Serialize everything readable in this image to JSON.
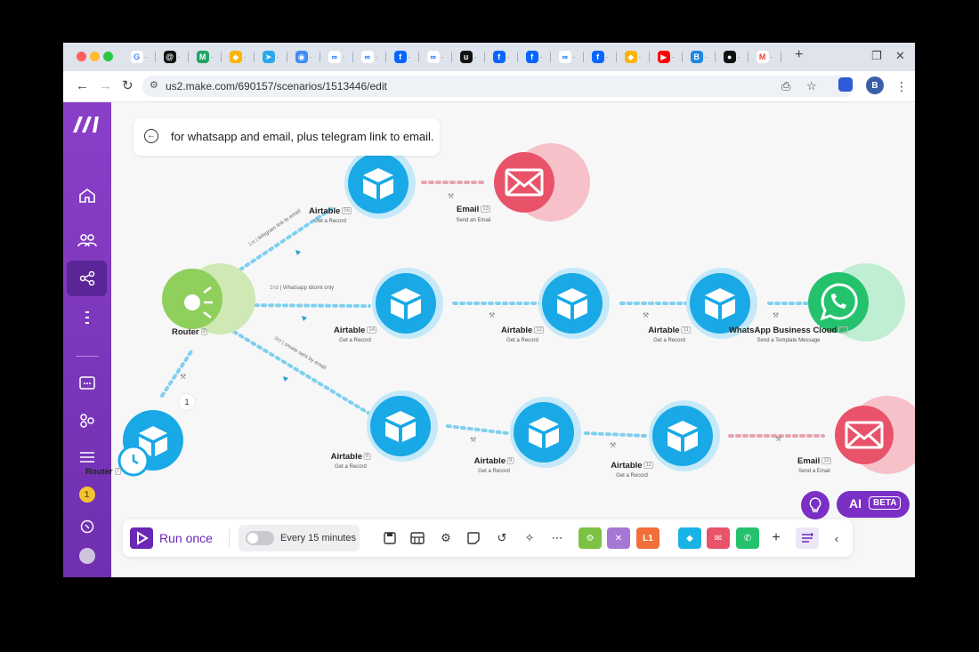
{
  "browser": {
    "tabs": [
      {
        "icon": "google-icon",
        "color": "#ffffff",
        "fg": "#4285f4",
        "glyph": "G"
      },
      {
        "icon": "threads-icon",
        "color": "#111111",
        "fg": "#ffffff",
        "glyph": "@"
      },
      {
        "icon": "sheets-icon",
        "color": "#1fa463",
        "fg": "#ffffff",
        "glyph": "M"
      },
      {
        "icon": "airtable-icon",
        "color": "#fcb400",
        "fg": "#ffffff",
        "glyph": "◆"
      },
      {
        "icon": "telegram-icon",
        "color": "#29a9eb",
        "fg": "#ffffff",
        "glyph": "➤"
      },
      {
        "icon": "app-icon",
        "color": "#3d8df5",
        "fg": "#ffffff",
        "glyph": "◉"
      },
      {
        "icon": "meta-icon",
        "color": "#ffffff",
        "fg": "#0866ff",
        "glyph": "∞"
      },
      {
        "icon": "meta-icon",
        "color": "#ffffff",
        "fg": "#0866ff",
        "glyph": "∞"
      },
      {
        "icon": "facebook-icon",
        "color": "#0866ff",
        "fg": "#ffffff",
        "glyph": "f"
      },
      {
        "icon": "meta-icon",
        "color": "#ffffff",
        "fg": "#0866ff",
        "glyph": "∞"
      },
      {
        "icon": "upwork-icon",
        "color": "#111111",
        "fg": "#ffffff",
        "glyph": "u"
      },
      {
        "icon": "facebook-icon",
        "color": "#0866ff",
        "fg": "#ffffff",
        "glyph": "f"
      },
      {
        "icon": "facebook-icon",
        "color": "#0866ff",
        "fg": "#ffffff",
        "glyph": "f"
      },
      {
        "icon": "meta-icon",
        "color": "#ffffff",
        "fg": "#0866ff",
        "glyph": "∞"
      },
      {
        "icon": "facebook-icon",
        "color": "#0866ff",
        "fg": "#ffffff",
        "glyph": "f"
      },
      {
        "icon": "airtable-icon",
        "color": "#fcb400",
        "fg": "#ffffff",
        "glyph": "◆"
      },
      {
        "icon": "youtube-icon",
        "color": "#ff0000",
        "fg": "#ffffff",
        "glyph": "▶"
      },
      {
        "icon": "app-icon",
        "color": "#1e88e5",
        "fg": "#ffffff",
        "glyph": "B"
      },
      {
        "icon": "github-icon",
        "color": "#111111",
        "fg": "#ffffff",
        "glyph": "●"
      },
      {
        "icon": "gmail-icon",
        "color": "#ffffff",
        "fg": "#ea4335",
        "glyph": "M"
      }
    ],
    "url": "us2.make.com/690157/scenarios/1513446/edit",
    "profile_initial": "B"
  },
  "prompt": {
    "text": "for whatsapp and email, plus telegram link to email."
  },
  "modules": [
    {
      "id": "router",
      "label": "Router",
      "badge": "2",
      "sub": "",
      "kind": "router"
    },
    {
      "id": "trigger",
      "label": "Router",
      "badge": "7",
      "sub": "",
      "kind": "airtable-trigger"
    },
    {
      "id": "a-top",
      "label": "Airtable",
      "badge": "55",
      "sub": "Get a Record",
      "kind": "airtable"
    },
    {
      "id": "e-top",
      "label": "Email",
      "badge": "13",
      "sub": "Send an Email",
      "kind": "email"
    },
    {
      "id": "a-mid-1",
      "label": "Airtable",
      "badge": "14",
      "sub": "Get a Record",
      "kind": "airtable"
    },
    {
      "id": "a-mid-2",
      "label": "Airtable",
      "badge": "12",
      "sub": "Get a Record",
      "kind": "airtable"
    },
    {
      "id": "a-mid-3",
      "label": "Airtable",
      "badge": "11",
      "sub": "Get a Record",
      "kind": "airtable"
    },
    {
      "id": "wa",
      "label": "WhatsApp Business Cloud",
      "badge": "13",
      "sub": "Send a Template Message",
      "kind": "whatsapp"
    },
    {
      "id": "a-bot-1",
      "label": "Airtable",
      "badge": "8",
      "sub": "Get a Record",
      "kind": "airtable"
    },
    {
      "id": "a-bot-2",
      "label": "Airtable",
      "badge": "9",
      "sub": "Get a Record",
      "kind": "airtable"
    },
    {
      "id": "a-bot-3",
      "label": "Airtable",
      "badge": "11",
      "sub": "Get a Record",
      "kind": "airtable"
    },
    {
      "id": "e-bot",
      "label": "Email",
      "badge": "10",
      "sub": "Send a Email",
      "kind": "email"
    }
  ],
  "routes": [
    {
      "id": "route-1",
      "order": "1st",
      "text": "telegram link to email"
    },
    {
      "id": "route-2",
      "order": "1nd",
      "text": "Whatsapp idiomt only"
    },
    {
      "id": "route-3",
      "order": "3rd",
      "text": "create sent by email"
    }
  ],
  "trigger_count": "1",
  "bottombar": {
    "run_label": "Run once",
    "schedule_label": "Every 15 minutes",
    "chips": [
      {
        "name": "tools-chip",
        "color": "#7dc242",
        "glyph": "⚙"
      },
      {
        "name": "flow-control-chip",
        "color": "#a678d6",
        "glyph": "✕"
      },
      {
        "name": "text-parser-chip",
        "color": "#f26e3a",
        "glyph": "L1"
      },
      {
        "name": "airtable-chip",
        "color": "#19b3e6",
        "glyph": "◆"
      },
      {
        "name": "email-chip",
        "color": "#e8536a",
        "glyph": "✉"
      },
      {
        "name": "whatsapp-chip",
        "color": "#25c26e",
        "glyph": "✆"
      }
    ]
  },
  "ai": {
    "label": "AI",
    "beta": "BETA"
  },
  "colors": {
    "accent": "#6b28b5",
    "airtable": "#19a9e6",
    "email": "#e8536a",
    "whatsapp": "#25c26e",
    "router": "#8fcf5c"
  }
}
